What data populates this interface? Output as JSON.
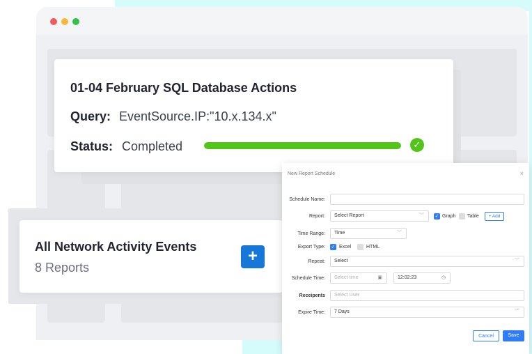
{
  "sql_card": {
    "title": "01-04 February SQL Database Actions",
    "query_label": "Query:",
    "query_value": "EventSource.IP:\"10.x.134.x\"",
    "status_label": "Status:",
    "status_value": "Completed",
    "progress_percent": 100,
    "check_icon": "✓"
  },
  "network_card": {
    "title": "All Network Activity Events",
    "subtitle": "8 Reports",
    "add_icon": "+"
  },
  "dialog": {
    "title": "New Report Schedule",
    "close_icon": "×",
    "schedule_name_label": "Schedule Name:",
    "schedule_name_value": "",
    "report_label": "Report:",
    "report_value": "Select Report",
    "graph_label": "Graph",
    "graph_checked": true,
    "table_label": "Table",
    "table_checked": false,
    "add_label": "+ Add",
    "time_range_label": "Time Range:",
    "time_range_value": "Time",
    "export_type_label": "Export Type:",
    "excel_label": "Excel",
    "excel_checked": true,
    "html_label": "HTML",
    "html_checked": false,
    "repeat_label": "Repeat:",
    "repeat_value": "Select",
    "schedule_time_label": "Schedule Time:",
    "date_placeholder": "Select time",
    "time_value": "12:02:23",
    "recipients_label": "Receipents",
    "recipients_placeholder": "Select User",
    "expire_time_label": "Expire Time:",
    "expire_time_value": "7 Days",
    "cancel_label": "Cancel",
    "save_label": "Save"
  },
  "colors": {
    "accent": "#2f7df6",
    "success": "#52c41a",
    "primary_button": "#1677d9"
  }
}
